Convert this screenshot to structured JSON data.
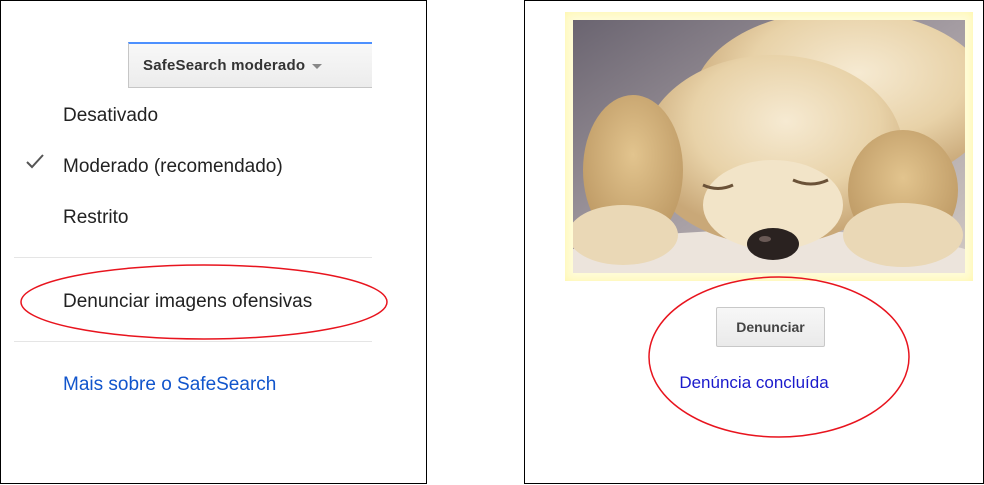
{
  "safesearch": {
    "button_label": "SafeSearch moderado",
    "options": [
      "Desativado",
      "Moderado (recomendado)",
      "Restrito"
    ],
    "selected_option": "Moderado (recomendado)",
    "report_link": "Denunciar imagens ofensivas",
    "more_link": "Mais sobre o SafeSearch"
  },
  "report_panel": {
    "report_button_label": "Denunciar",
    "confirmation": "Denúncia concluída"
  },
  "colors": {
    "accent_blue": "#4d90fe",
    "link_blue": "#1155cc",
    "annotation_red": "#e8141e"
  },
  "icons": [
    "check-icon",
    "caret-down-icon"
  ]
}
